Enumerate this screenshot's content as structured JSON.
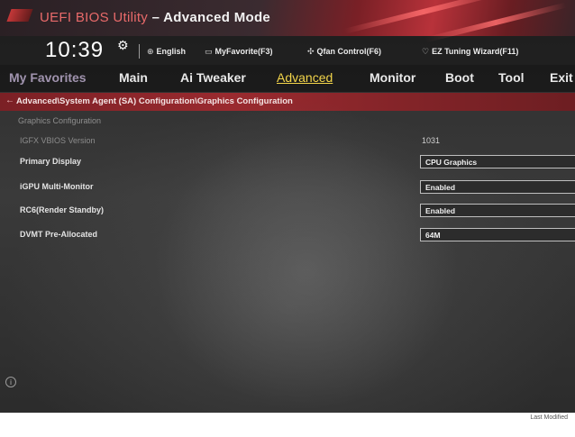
{
  "header": {
    "title_prefix": "UEFI BIOS Utility",
    "title_suffix": " – Advanced Mode"
  },
  "status": {
    "date": "",
    "time": "10:39",
    "gear_icon": "gear-icon",
    "language": "English",
    "favorites": "MyFavorite(F3)",
    "qfan": "Qfan Control(F6)",
    "ez_tuning": "EZ Tuning Wizard(F11)"
  },
  "menu": {
    "tabs": [
      {
        "label": "My Favorites"
      },
      {
        "label": "Main"
      },
      {
        "label": "Ai Tweaker"
      },
      {
        "label": "Advanced",
        "active": true
      },
      {
        "label": "Monitor"
      },
      {
        "label": "Boot"
      },
      {
        "label": "Tool"
      },
      {
        "label": "Exit"
      }
    ]
  },
  "breadcrumb": {
    "text": "Advanced\\System Agent (SA) Configuration\\Graphics Configuration"
  },
  "content": {
    "section_header": "Graphics Configuration",
    "rows": [
      {
        "label": "IGFX VBIOS Version",
        "value": "1031"
      },
      {
        "label": "Primary Display",
        "value": "CPU Graphics"
      },
      {
        "label": "iGPU Multi-Monitor",
        "value": "Enabled"
      },
      {
        "label": "RC6(Render Standby)",
        "value": "Enabled"
      },
      {
        "label": "DVMT Pre-Allocated",
        "value": "64M"
      }
    ]
  },
  "footer": {
    "text": "Last Modified"
  },
  "colors": {
    "accent_red": "#9a2a2f",
    "active_tab": "#f3d54a",
    "background": "#2b2b2b"
  }
}
